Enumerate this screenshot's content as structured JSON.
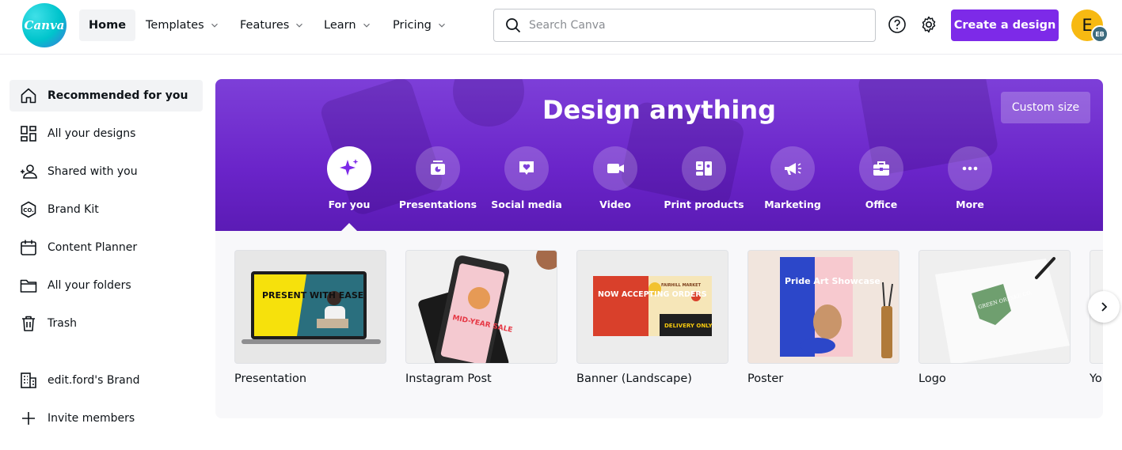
{
  "app": {
    "logo_text": "Canva"
  },
  "nav": {
    "home": "Home",
    "templates": "Templates",
    "features": "Features",
    "learn": "Learn",
    "pricing": "Pricing"
  },
  "search": {
    "placeholder": "Search Canva"
  },
  "header": {
    "create_label": "Create a design",
    "avatar_initial": "E",
    "avatar_badge": "EB"
  },
  "sidebar": {
    "items": [
      {
        "label": "Recommended for you",
        "icon": "home-icon",
        "active": true
      },
      {
        "label": "All your designs",
        "icon": "grid-icon"
      },
      {
        "label": "Shared with you",
        "icon": "shared-users-icon"
      },
      {
        "label": "Brand Kit",
        "icon": "brand-kit-icon"
      },
      {
        "label": "Content Planner",
        "icon": "calendar-icon"
      },
      {
        "label": "All your folders",
        "icon": "folder-icon"
      },
      {
        "label": "Trash",
        "icon": "trash-icon"
      }
    ],
    "brand": "edit.ford's Brand",
    "invite": "Invite members"
  },
  "banner": {
    "title": "Design anything",
    "custom_size": "Custom size",
    "categories": [
      {
        "label": "For you",
        "icon": "sparkle-icon",
        "active": true
      },
      {
        "label": "Presentations",
        "icon": "presentation-icon"
      },
      {
        "label": "Social media",
        "icon": "heart-chat-icon"
      },
      {
        "label": "Video",
        "icon": "video-camera-icon"
      },
      {
        "label": "Print products",
        "icon": "print-icon"
      },
      {
        "label": "Marketing",
        "icon": "megaphone-icon"
      },
      {
        "label": "Office",
        "icon": "briefcase-icon"
      },
      {
        "label": "More",
        "icon": "more-dots-icon"
      }
    ]
  },
  "cards": [
    {
      "label": "Presentation",
      "thumb_text": "PRESENT WITH EASE"
    },
    {
      "label": "Instagram Post",
      "thumb_text": "MID-YEAR SALE"
    },
    {
      "label": "Banner (Landscape)",
      "thumb_text": "NOW ACCEPTING ORDERS",
      "thumb_text2": "DELIVERY ONLY",
      "thumb_text3": "FAIRHILL MARKET"
    },
    {
      "label": "Poster",
      "thumb_text": "Pride Art Showcase"
    },
    {
      "label": "Logo",
      "thumb_text": "GREEN ORESKE CO."
    },
    {
      "label": "Yo"
    }
  ],
  "colors": {
    "accent": "#7d2ae8",
    "teal": "#00c4cc"
  }
}
